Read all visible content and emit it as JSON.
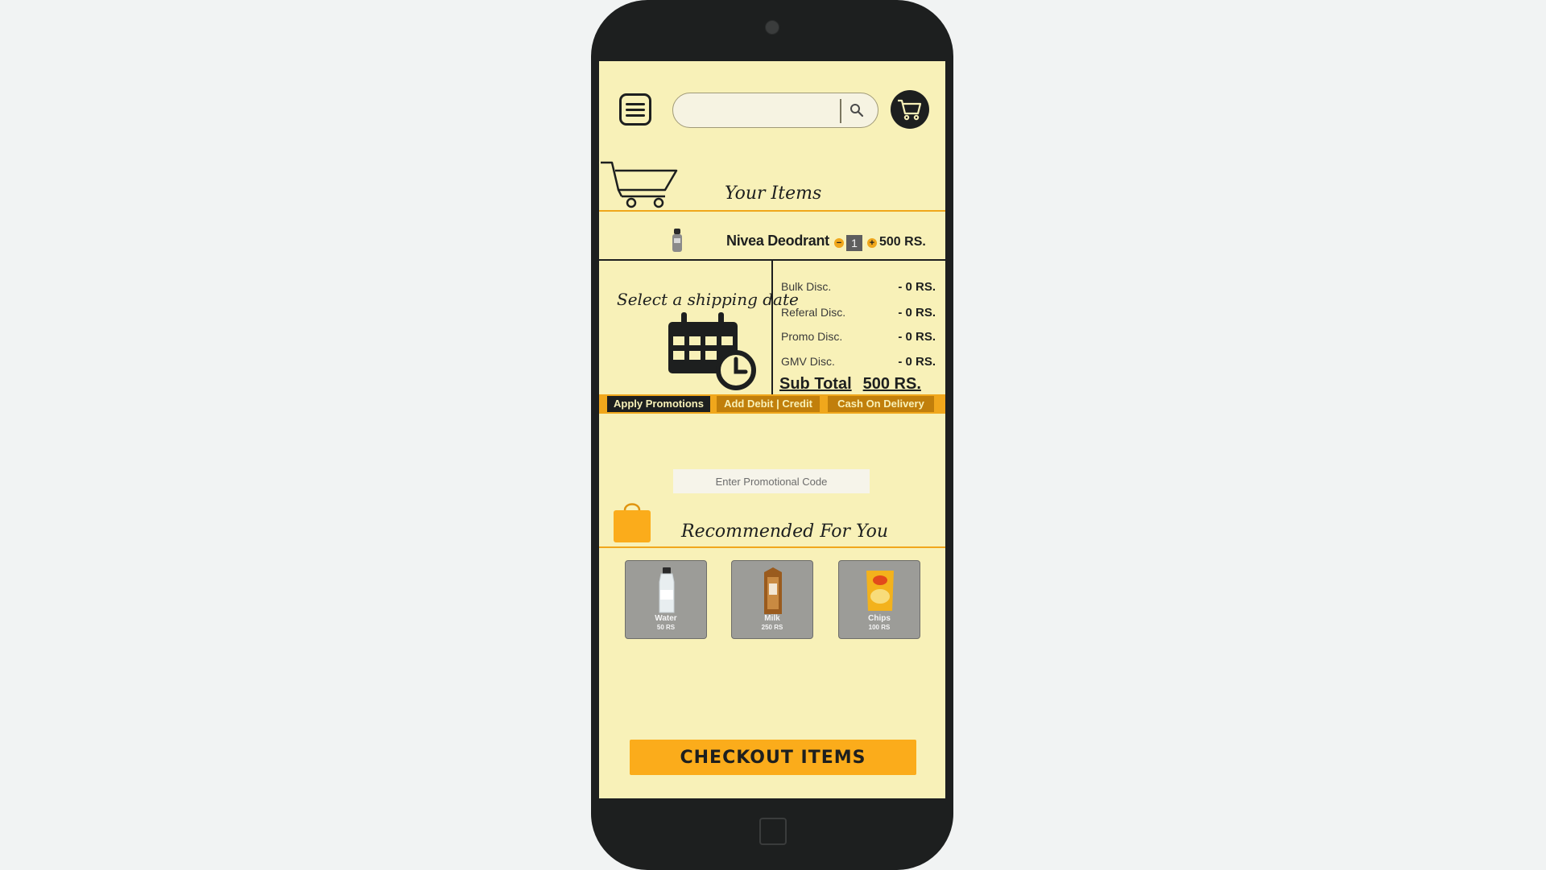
{
  "header": {
    "search_placeholder": "",
    "icons": [
      "menu-icon",
      "search-icon",
      "cart-icon"
    ]
  },
  "cart": {
    "title": "Your Items",
    "items": [
      {
        "name": "Nivea Deodrant",
        "quantity": "1",
        "price": "500 RS.",
        "minus": "−",
        "plus": "+"
      }
    ]
  },
  "shipping": {
    "title": "Select a shipping date"
  },
  "discounts": [
    {
      "label": "Bulk Disc.",
      "value": "- 0 RS."
    },
    {
      "label": "Referal Disc.",
      "value": "- 0 RS."
    },
    {
      "label": "Promo Disc.",
      "value": "- 0 RS."
    },
    {
      "label": "GMV Disc.",
      "value": "- 0 RS."
    }
  ],
  "subtotal": {
    "label": "Sub Total",
    "value": "500 RS."
  },
  "payment_tabs": [
    "Apply Promotions",
    "Add Debit | Credit",
    "Cash On Delivery"
  ],
  "promo": {
    "placeholder": "Enter Promotional Code"
  },
  "recommended": {
    "title": "Recommended For You",
    "items": [
      {
        "name": "Water",
        "price": "50 RS"
      },
      {
        "name": "Milk",
        "price": "250 RS"
      },
      {
        "name": "Chips",
        "price": "100 RS"
      }
    ]
  },
  "checkout": {
    "label": "CHECKOUT  ITEMS"
  },
  "colors": {
    "accent": "#fbac1b",
    "background": "#f8f1b8",
    "dark": "#1d1f1f",
    "tab_brown": "#c17f0b"
  }
}
